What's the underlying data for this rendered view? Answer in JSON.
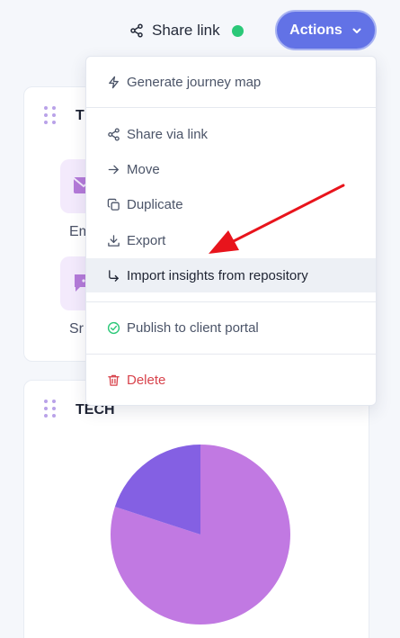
{
  "toolbar": {
    "share_label": "Share link",
    "share_icon": "share-nodes-icon",
    "status_color": "#2bc878",
    "actions_label": "Actions",
    "actions_icon": "chevron-down-icon",
    "accent": "#6272e6"
  },
  "cards": [
    {
      "title": "T",
      "tiles": [
        {
          "label": "Em",
          "icon": "email-icon"
        },
        {
          "label": "Sr",
          "icon": "chat-bubble-icon"
        }
      ]
    },
    {
      "title": "TECH",
      "chart_data": {
        "type": "pie",
        "slices": [
          {
            "value": 80,
            "color": "#c179e2"
          },
          {
            "value": 20,
            "color": "#8460e3"
          }
        ]
      }
    }
  ],
  "menu": {
    "items": [
      {
        "label": "Generate journey map",
        "icon": "lightning-icon"
      },
      {
        "label": "Share via link",
        "icon": "share-nodes-icon"
      },
      {
        "label": "Move",
        "icon": "arrow-right-icon"
      },
      {
        "label": "Duplicate",
        "icon": "duplicate-icon"
      },
      {
        "label": "Export",
        "icon": "download-icon"
      },
      {
        "label": "Import insights from repository",
        "icon": "corner-down-right-icon",
        "hovered": true
      },
      {
        "label": "Publish to client portal",
        "icon": "check-circle-icon"
      },
      {
        "label": "Delete",
        "icon": "trash-icon"
      }
    ],
    "danger_color": "#d8434c",
    "success_color": "#2bc878"
  },
  "annotation": {
    "arrow_color": "#e8141c"
  }
}
